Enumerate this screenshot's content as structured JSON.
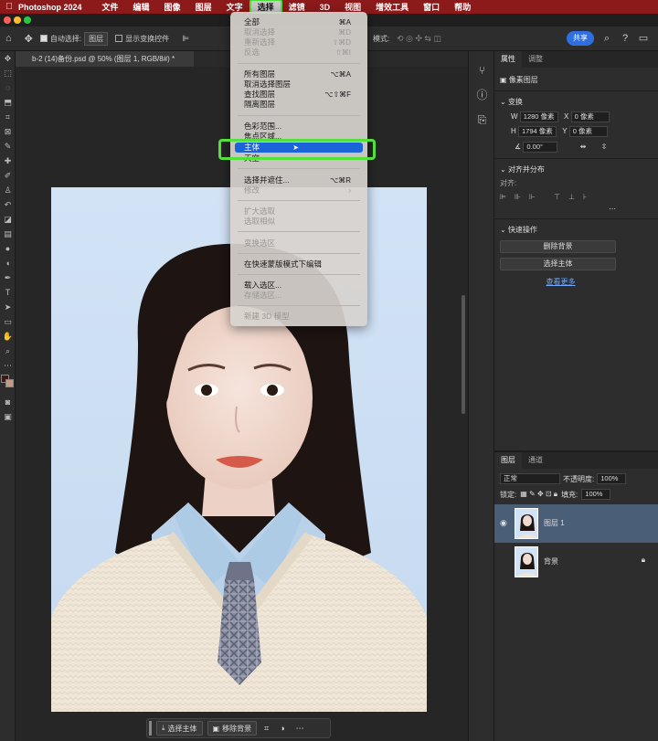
{
  "menubar": {
    "app": "Photoshop 2024",
    "items": [
      "文件",
      "编辑",
      "图像",
      "图层",
      "文字",
      "选择",
      "滤镜",
      "3D",
      "视图",
      "增效工具",
      "窗口",
      "帮助"
    ],
    "active_item": "选择"
  },
  "options_bar": {
    "auto_select_label": "自动选择:",
    "auto_select_value": "图层",
    "show_transform_label": "显示变换控件",
    "mode_label": "模式:",
    "share_label": "共享"
  },
  "document": {
    "tab_title": "b-2 (14)备份.psd @ 50% (图层 1, RGB/8#) *"
  },
  "select_menu": {
    "items": [
      {
        "label": "全部",
        "shortcut": "⌘A",
        "enabled": true
      },
      {
        "label": "取消选择",
        "shortcut": "⌘D",
        "enabled": false
      },
      {
        "label": "重新选择",
        "shortcut": "⇧⌘D",
        "enabled": false
      },
      {
        "label": "反选",
        "shortcut": "⇧⌘I",
        "enabled": false
      },
      {
        "label": "所有图层",
        "shortcut": "⌥⌘A",
        "enabled": true
      },
      {
        "label": "取消选择图层",
        "shortcut": "",
        "enabled": true
      },
      {
        "label": "查找图层",
        "shortcut": "⌥⇧⌘F",
        "enabled": true
      },
      {
        "label": "隔离图层",
        "shortcut": "",
        "enabled": true
      },
      {
        "label": "色彩范围...",
        "shortcut": "",
        "enabled": true
      },
      {
        "label": "焦点区域...",
        "shortcut": "",
        "enabled": true
      },
      {
        "label": "主体",
        "shortcut": "",
        "enabled": true,
        "highlighted": true
      },
      {
        "label": "天空",
        "shortcut": "",
        "enabled": true
      },
      {
        "label": "选择并遮住...",
        "shortcut": "⌥⌘R",
        "enabled": true
      },
      {
        "label": "修改",
        "shortcut": "›",
        "enabled": false
      },
      {
        "label": "扩大选取",
        "shortcut": "",
        "enabled": false
      },
      {
        "label": "选取相似",
        "shortcut": "",
        "enabled": false
      },
      {
        "label": "变换选区",
        "shortcut": "",
        "enabled": false
      },
      {
        "label": "在快速蒙版模式下编辑",
        "shortcut": "",
        "enabled": true
      },
      {
        "label": "载入选区...",
        "shortcut": "",
        "enabled": true
      },
      {
        "label": "存储选区...",
        "shortcut": "",
        "enabled": false
      },
      {
        "label": "新建 3D 模型",
        "shortcut": "",
        "enabled": false
      }
    ]
  },
  "properties": {
    "tabs": [
      "属性",
      "调整"
    ],
    "layer_type": "像素图层",
    "transform_title": "变换",
    "w_label": "W",
    "w_value": "1280 像素",
    "x_label": "X",
    "x_value": "0 像素",
    "h_label": "H",
    "h_value": "1794 像素",
    "y_label": "Y",
    "y_value": "0 像素",
    "angle_value": "0.00°",
    "align_title": "对齐并分布",
    "align_label": "对齐:",
    "quick_title": "快速操作",
    "remove_bg": "删除背景",
    "select_subject": "选择主体",
    "see_more": "查看更多"
  },
  "layers": {
    "tabs": [
      "图层",
      "通道"
    ],
    "blend_mode": "正常",
    "opacity_label": "不透明度:",
    "opacity_value": "100%",
    "lock_label": "锁定:",
    "fill_label": "填充:",
    "fill_value": "100%",
    "rows": [
      {
        "name": "图层 1",
        "selected": true
      },
      {
        "name": "背景",
        "selected": false
      }
    ]
  },
  "context_bar": {
    "select_subject": "选择主体",
    "remove_bg": "移除背景"
  },
  "colors": {
    "menubar": "#8c1a1a",
    "highlight": "#1b63d8",
    "annotation": "#54e03a",
    "share": "#2f6fe0",
    "photo_bg": "#cfe0f5"
  }
}
